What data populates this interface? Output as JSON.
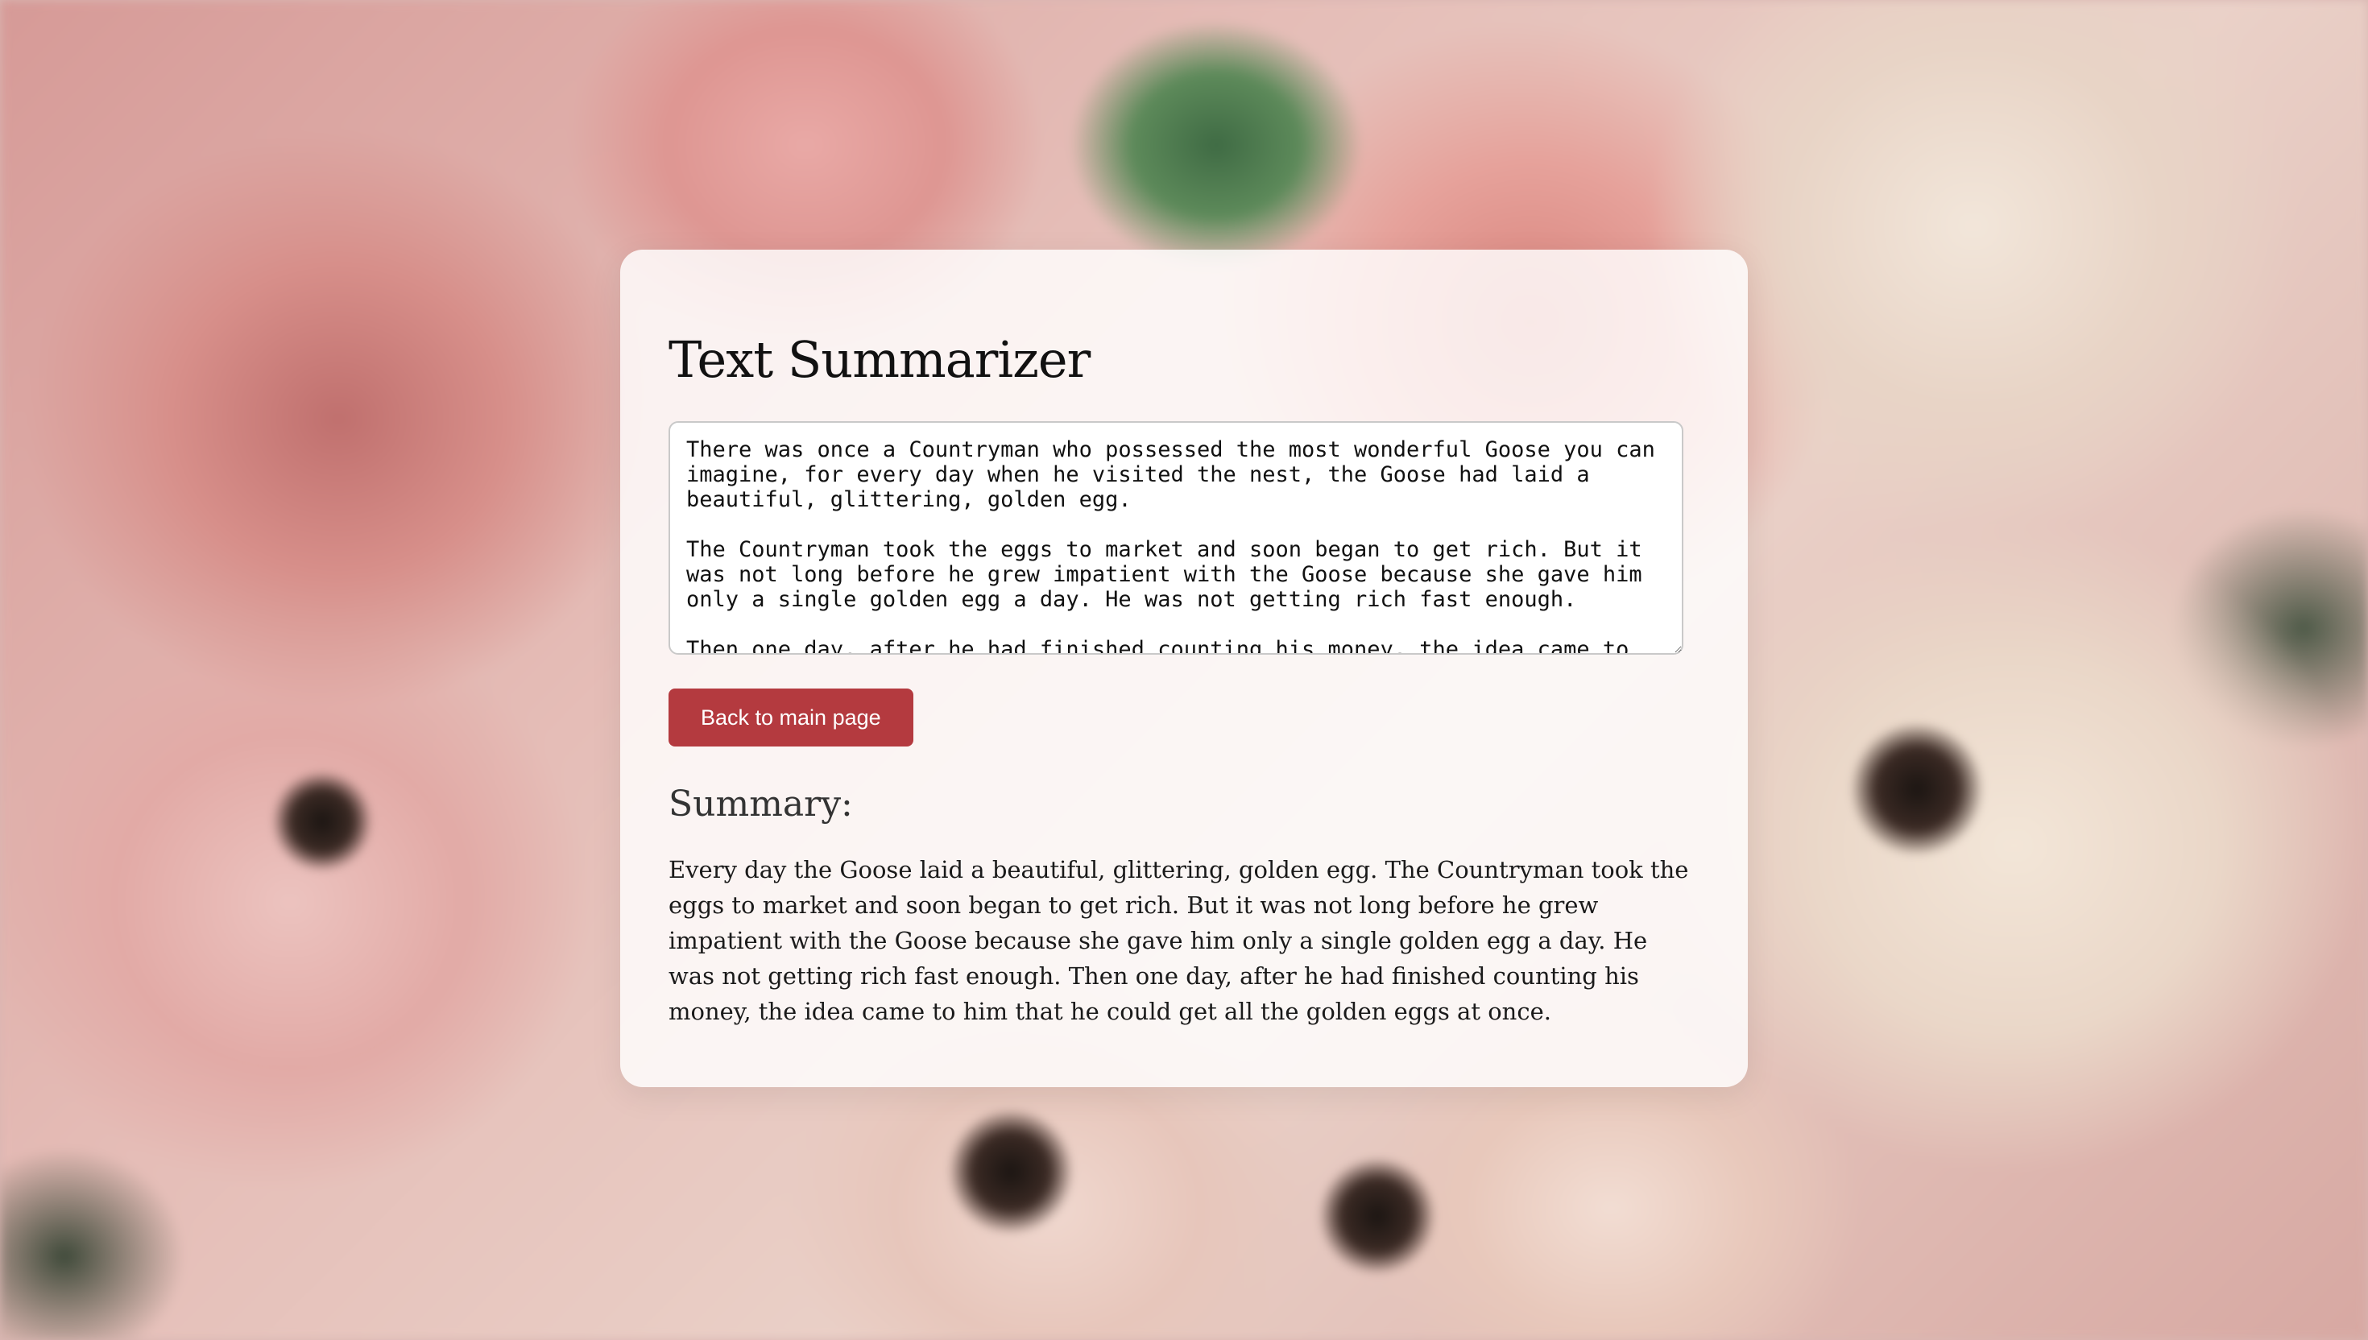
{
  "app": {
    "title": "Text Summarizer"
  },
  "input": {
    "text": "There was once a Countryman who possessed the most wonderful Goose you can imagine, for every day when he visited the nest, the Goose had laid a beautiful, glittering, golden egg.\n\nThe Countryman took the eggs to market and soon began to get rich. But it was not long before he grew impatient with the Goose because she gave him only a single golden egg a day. He was not getting rich fast enough.\n\nThen one day, after he had finished counting his money, the idea came to"
  },
  "actions": {
    "back_label": "Back to main page"
  },
  "summary": {
    "heading": "Summary:",
    "text": "Every day the Goose laid a beautiful, glittering, golden egg. The Countryman took the eggs to market and soon began to get rich. But it was not long before he grew impatient with the Goose because she gave him only a single golden egg a day. He was not getting rich fast enough. Then one day, after he had finished counting his money, the idea came to him that he could get all the golden eggs at once."
  },
  "theme": {
    "accent": "#b43a3f",
    "card_background": "rgba(255,255,255,0.82)"
  }
}
